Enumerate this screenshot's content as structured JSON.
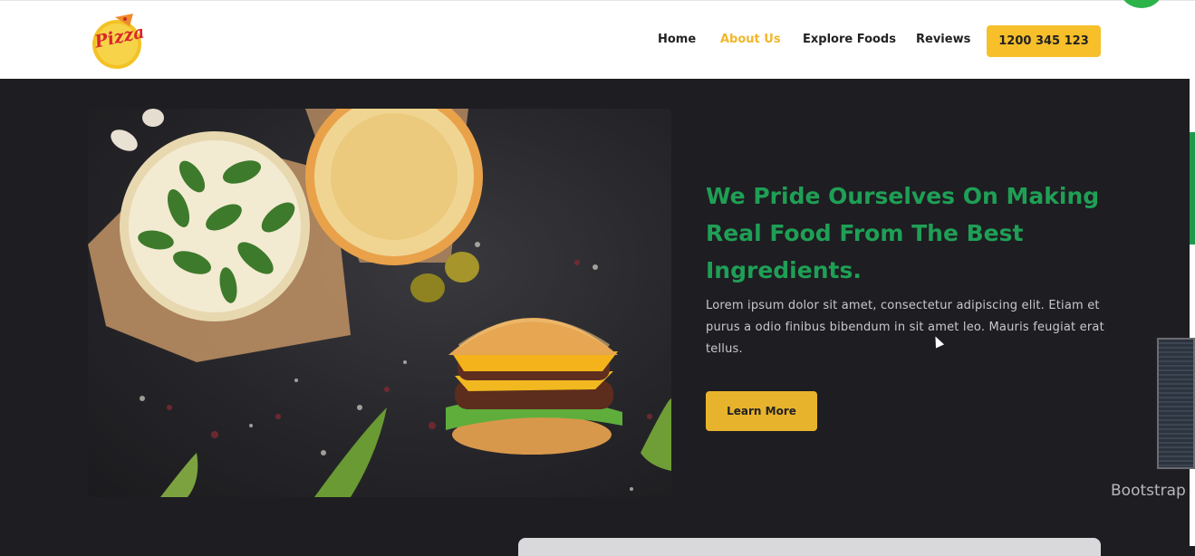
{
  "header": {
    "logo_text": "Pizza",
    "nav": [
      {
        "label": "Home",
        "active": false
      },
      {
        "label": "About Us",
        "active": true
      },
      {
        "label": "Explore Foods",
        "active": false
      },
      {
        "label": "Reviews",
        "active": false
      }
    ],
    "phone": "1200 345 123"
  },
  "hero": {
    "headline": "We Pride Ourselves On Making Real Food From The Best Ingredients.",
    "paragraph": "Lorem ipsum dolor sit amet, consectetur adipiscing elit. Etiam et purus a odio finibus bibendum in sit amet leo. Mauris feugiat erat tellus.",
    "button": "Learn More",
    "image_alt": "pizza and burger on dark table"
  },
  "overlay": {
    "side_label": "Bootstrap"
  },
  "colors": {
    "accent": "#f7bf2a",
    "headline": "#1f9f55",
    "background": "#1e1d22"
  }
}
